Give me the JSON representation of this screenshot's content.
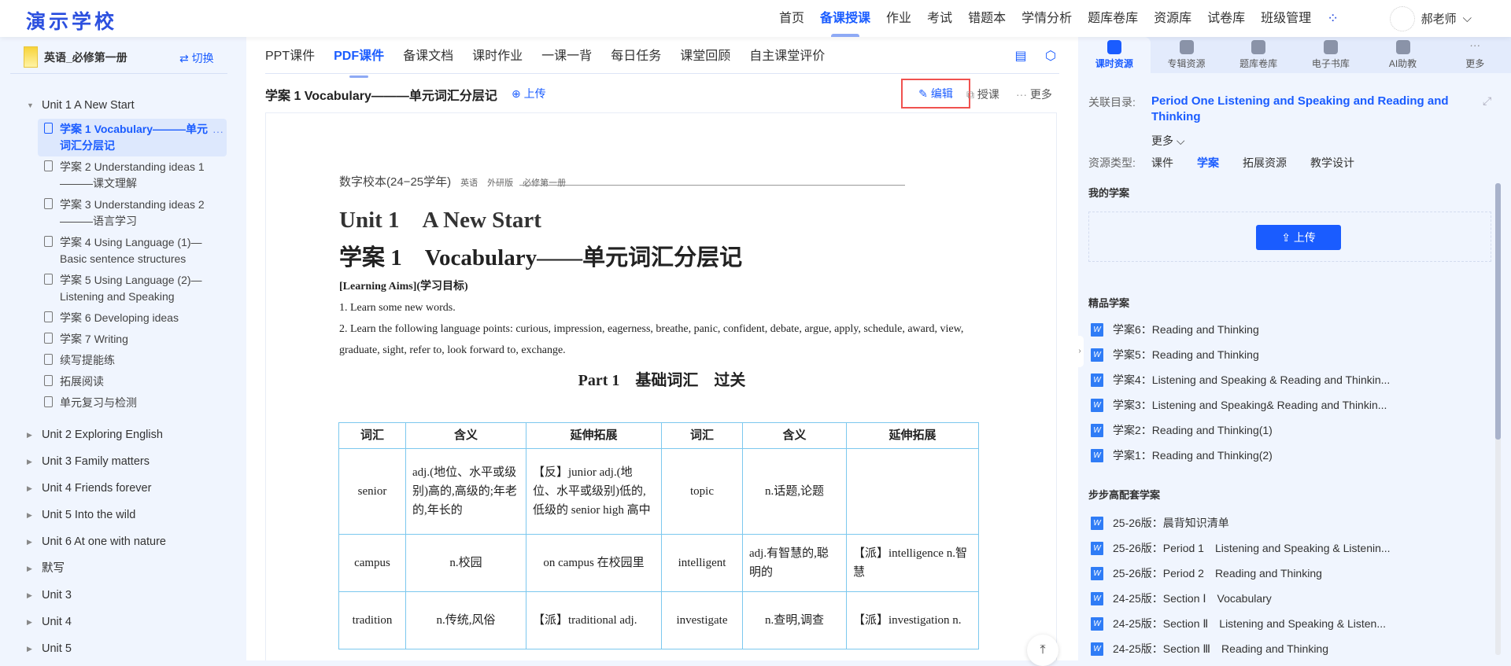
{
  "header": {
    "logo": "演示学校",
    "nav": [
      "首页",
      "备课授课",
      "作业",
      "考试",
      "错题本",
      "学情分析",
      "题库卷库",
      "资源库",
      "试卷库",
      "班级管理"
    ],
    "active_nav": "备课授课",
    "user": "郝老师"
  },
  "sidebar": {
    "book": "英语_必修第一册",
    "switch": "切换",
    "unit1": "Unit 1 A New Start",
    "leaves": [
      "学案 1 Vocabulary———单元词汇分层记",
      "学案 2 Understanding ideas 1———课文理解",
      "学案 3 Understanding ideas 2———语言学习",
      "学案 4 Using Language (1)—Basic sentence structures",
      "学案 5 Using Language (2)—Listening and Speaking",
      "学案 6 Developing ideas",
      "学案 7 Writing",
      "续写提能练",
      "拓展阅读",
      "单元复习与检测"
    ],
    "units": [
      "Unit 2 Exploring English",
      "Unit 3 Family matters",
      "Unit 4 Friends forever",
      "Unit 5 Into the wild",
      "Unit 6 At one with nature",
      "默写",
      "Unit 3",
      "Unit 4",
      "Unit 5"
    ]
  },
  "main": {
    "tabs": [
      "PPT课件",
      "PDF课件",
      "备课文档",
      "课时作业",
      "一课一背",
      "每日任务",
      "课堂回顾",
      "自主课堂评价"
    ],
    "active_tab": "PDF课件",
    "doc_title": "学案 1 Vocabulary———单元词汇分层记",
    "upload": "上传",
    "edit": "编辑",
    "teach": "授课",
    "more": "更多"
  },
  "document": {
    "header": "数字校本(24−25学年)",
    "header_tags": [
      "英语",
      "外研版",
      "必修第一册"
    ],
    "unit": "Unit 1　A New Start",
    "title": "学案 1　Vocabulary——单元词汇分层记",
    "aims_label": "[Learning Aims](学习目标)",
    "aims": [
      "1. Learn some new words.",
      "2. Learn the following language points: curious, impression, eagerness, breathe, panic, confident, debate, argue, apply, schedule, award, view, graduate, sight, refer to, look forward to, exchange."
    ],
    "part": "Part 1　基础词汇　过关",
    "table": {
      "headers": [
        "词汇",
        "含义",
        "延伸拓展",
        "词汇",
        "含义",
        "延伸拓展"
      ],
      "rows": [
        [
          "senior",
          "adj.(地位、水平或级别)高的,高级的;年老的,年长的",
          "【反】junior adj.(地位、水平或级别)低的,低级的 senior high 高中",
          "topic",
          "n.话题,论题",
          ""
        ],
        [
          "campus",
          "n.校园",
          "on campus 在校园里",
          "intelligent",
          "adj.有智慧的,聪明的",
          "【派】intelligence n.智慧"
        ],
        [
          "tradition",
          "n.传统,风俗",
          "【派】traditional adj.",
          "investigate",
          "n.查明,调查",
          "【派】investigation n."
        ]
      ]
    }
  },
  "right": {
    "tabs": [
      "课时资源",
      "专辑资源",
      "题库卷库",
      "电子书库",
      "AI助教",
      "更多"
    ],
    "active_tab": "课时资源",
    "catalog_label": "关联目录:",
    "catalog": "Period One Listening and Speaking and Reading and Thinking",
    "more": "更多",
    "type_label": "资源类型:",
    "types": [
      "课件",
      "学案",
      "拓展资源",
      "教学设计"
    ],
    "active_type": "学案",
    "my_title": "我的学案",
    "upload": "上传",
    "premium_title": "精品学案",
    "premium": [
      "学案6：Reading and Thinking",
      "学案5：Reading and Thinking",
      "学案4：Listening and Speaking & Reading and Thinkin...",
      "学案3：Listening and Speaking& Reading and Thinkin...",
      "学案2：Reading and Thinking(1)",
      "学案1：Reading and Thinking(2)"
    ],
    "bbg_title": "步步高配套学案",
    "bbg": [
      "25-26版：晨背知识清单",
      "25-26版：Period 1　Listening and Speaking & Listenin...",
      "25-26版：Period 2　Reading and Thinking",
      "24-25版：Section Ⅰ　Vocabulary",
      "24-25版：Section Ⅱ　Listening and Speaking & Listen...",
      "24-25版：Section Ⅲ　Reading and Thinking"
    ]
  },
  "colors": {
    "accent": "#1a5cff",
    "panel": "#f0f5fe",
    "highlight": "#f0524f"
  }
}
